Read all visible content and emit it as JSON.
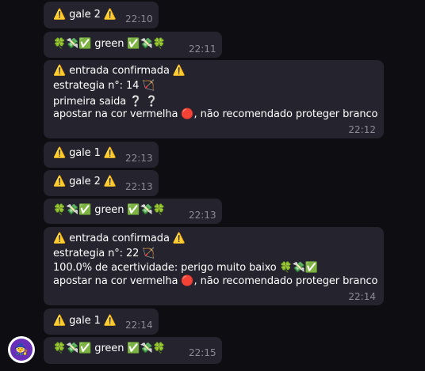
{
  "messages": [
    {
      "text": "⚠️ gale 2 ⚠️",
      "time": "22:10"
    },
    {
      "text": "🍀💸✅ green ✅💸🍀",
      "time": "22:11"
    },
    {
      "lines": [
        "⚠️ entrada confirmada ⚠️",
        "estrategia n°: 14 🏹",
        "primeira saida ❔ ❔",
        "apostar na cor vermelha 🔴, não recomendado proteger branco"
      ],
      "time": "22:12"
    },
    {
      "text": "⚠️ gale 1 ⚠️",
      "time": "22:13"
    },
    {
      "text": "⚠️ gale 2 ⚠️",
      "time": "22:13"
    },
    {
      "text": "🍀💸✅ green ✅💸🍀",
      "time": "22:13"
    },
    {
      "lines": [
        "⚠️ entrada confirmada ⚠️",
        "estrategia n°: 22 🏹",
        "100.0% de acertividade: perigo muito baixo 🍀💸✅",
        "apostar na cor vermelha 🔴, não recomendado proteger branco"
      ],
      "time": "22:14"
    },
    {
      "text": "⚠️ gale 1 ⚠️",
      "time": "22:14"
    },
    {
      "text": "🍀💸✅ green ✅💸🍀",
      "time": "22:15"
    }
  ],
  "avatar": {
    "icon": "wizard-hat-icon",
    "glyph": "🧙",
    "color": "#6a2fb8"
  }
}
